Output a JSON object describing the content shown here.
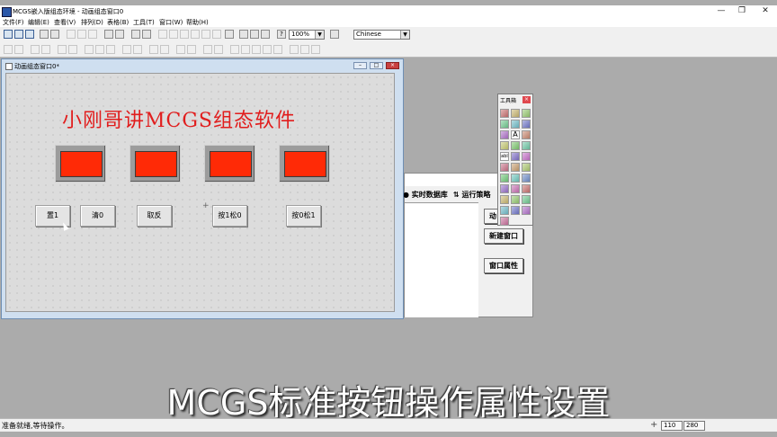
{
  "window": {
    "title": "MCGS嵌入版组态环境 - 动画组态窗口0",
    "minimize_glyph": "—",
    "restore_glyph": "❐",
    "close_glyph": "✕"
  },
  "menu": [
    "文件(F)",
    "编辑(E)",
    "查看(V)",
    "排列(D)",
    "表格(B)",
    "工具(T)",
    "窗口(W)",
    "帮助(H)"
  ],
  "toolbar": {
    "zoom": "100%",
    "language": "Chinese",
    "help_label": "?"
  },
  "drawing_window": {
    "title": "动画组态窗口0*"
  },
  "canvas": {
    "heading": "小刚哥讲MCGS组态软件",
    "indicator_color": "#ff2a06",
    "buttons": [
      "置1",
      "清0",
      "取反",
      "按1松0",
      "按0松1"
    ]
  },
  "workspace": {
    "tabs": [
      "实时数据库",
      "运行策略"
    ],
    "side_buttons": [
      "动",
      "新建窗口",
      "窗口属性"
    ]
  },
  "toolbox": {
    "title": "工具箱",
    "close_glyph": "×",
    "tools": [
      "pointer-icon",
      "line-icon",
      "arc-icon",
      "rectangle-icon",
      "rounded-rectangle-icon",
      "ellipse-icon",
      "polygon-icon",
      "label-icon",
      "bitmap-icon",
      "image-icon",
      "blank-icon",
      "color-icon",
      "text-icon",
      "list-icon",
      "component-icon",
      "bracket-icon",
      "trend-icon",
      "meter-icon",
      "switch-icon",
      "circle-icon",
      "rotate-icon",
      "chart-icon",
      "gauge-icon",
      "display-icon",
      "grid-icon",
      "bar-icon",
      "object-icon",
      "curve-icon",
      "frame-icon",
      "window-icon",
      "picture-icon"
    ],
    "tool_glyphs": {
      "text-icon": "abl",
      "label-icon": "A"
    }
  },
  "caption": "MCGS标准按钮操作属性设置",
  "status": {
    "text": "准备就绪,等待操作。",
    "x": "110",
    "y": "280"
  }
}
